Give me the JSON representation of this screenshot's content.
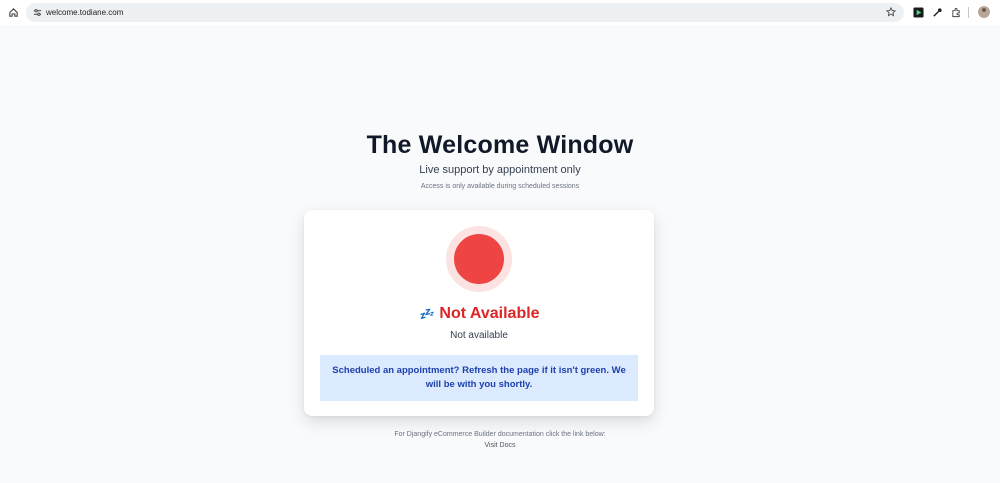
{
  "browser": {
    "url": "welcome.todiane.com",
    "icons": {
      "home": "home-icon",
      "site_info": "site-settings-icon",
      "bookmark": "star-icon",
      "ext1": "media-extension-icon",
      "ext2": "eyedropper-extension-icon",
      "ext3": "puzzle-extensions-icon",
      "profile": "avatar"
    }
  },
  "page": {
    "title": "The Welcome Window",
    "subtitle": "Live support by appointment only",
    "note": "Access is only available during scheduled sessions"
  },
  "status_card": {
    "indicator_color": "#ef4444",
    "status_icon": "zzz-icon",
    "status_icon_glyph": "💤",
    "status_title": "Not Available",
    "status_subtitle": "Not available",
    "info_text": "Scheduled an appointment? Refresh the page if it isn't green. We will be with you shortly."
  },
  "footer": {
    "text": "For Djangify eCommerce Builder documentation click the link below:",
    "link_label": "Visit Docs"
  },
  "colors": {
    "background": "#f8fafc",
    "status_red": "#dc2626",
    "info_bg": "#dbeafe",
    "info_text": "#1e40af"
  }
}
